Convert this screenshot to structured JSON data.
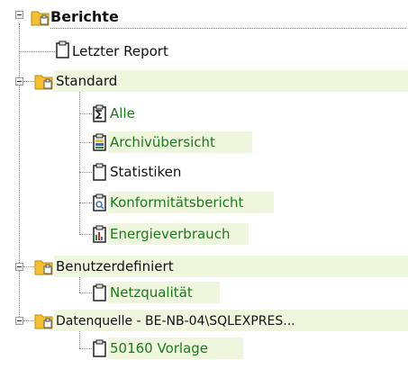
{
  "tree": {
    "root": {
      "label": "Berichte"
    },
    "letzter_report": {
      "label": "Letzter Report"
    },
    "standard": {
      "label": "Standard",
      "children": {
        "alle": {
          "label": "Alle"
        },
        "archivuebersicht": {
          "label": "Archivübersicht"
        },
        "statistiken": {
          "label": "Statistiken"
        },
        "konformitaet": {
          "label": "Konformitätsbericht"
        },
        "energie": {
          "label": "Energieverbrauch"
        }
      }
    },
    "benutzerdefiniert": {
      "label": "Benutzerdefiniert",
      "children": {
        "netzqualitaet": {
          "label": "Netzqualität"
        }
      }
    },
    "datenquelle": {
      "label": "Datenquelle - BE-NB-04\\SQLEXPRES...",
      "children": {
        "vorlage": {
          "label": "50160 Vorlage"
        }
      }
    }
  },
  "colors": {
    "highlight": "#eef6de",
    "green_text": "#1c7a1c",
    "folder": "#f4c030"
  },
  "icons": [
    "folder-icon",
    "clipboard-icon",
    "sum-icon",
    "archive-icon",
    "compliance-icon",
    "energy-chart-icon",
    "expand-minus-icon"
  ]
}
